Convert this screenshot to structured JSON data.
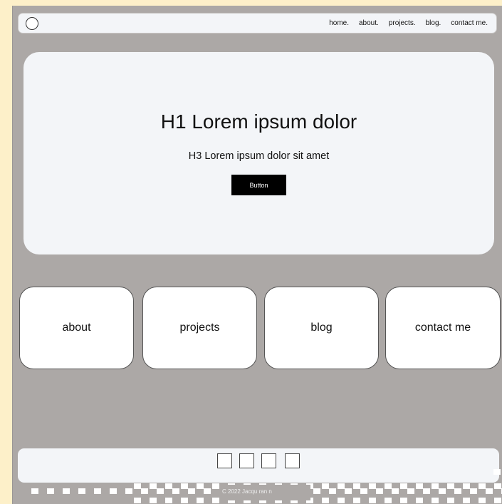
{
  "navbar": {
    "logo_icon": "circle-logo-icon",
    "links": [
      "home.",
      "about.",
      "projects.",
      "blog.",
      "contact me."
    ]
  },
  "hero": {
    "title": "H1 Lorem ipsum dolor",
    "subtitle": "H3 Lorem ipsum dolor sit amet",
    "button_label": "Button"
  },
  "cards": [
    {
      "label": "about"
    },
    {
      "label": "projects"
    },
    {
      "label": "blog"
    },
    {
      "label": "contact me"
    }
  ],
  "footer": {
    "social_icons": [
      "social-icon-1",
      "social-icon-2",
      "social-icon-3",
      "social-icon-4"
    ],
    "copyright": "C 2022 Jacqu   ran  n"
  },
  "colors": {
    "page_background": "#fdf0c9",
    "canvas_gray": "#aca8a6",
    "panel": "#f3f5f8",
    "button": "#000000"
  }
}
